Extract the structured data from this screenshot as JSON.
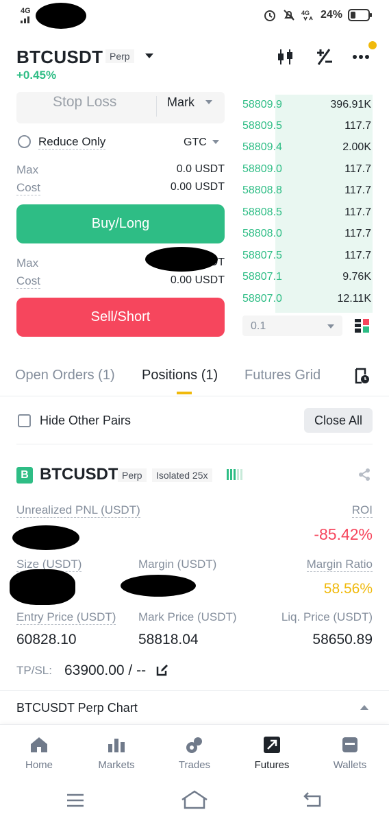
{
  "status_bar": {
    "network": "4G",
    "battery": "24%"
  },
  "header": {
    "pair": "BTCUSDT",
    "contract_type": "Perp",
    "change": "+0.45%"
  },
  "order_form": {
    "stop_loss_placeholder": "Stop Loss",
    "price_type": "Mark",
    "reduce_only": "Reduce Only",
    "time_in_force": "GTC",
    "buy": {
      "max_label": "Max",
      "max_value": "0.0 USDT",
      "cost_label": "Cost",
      "cost_value": "0.00 USDT",
      "button": "Buy/Long"
    },
    "sell": {
      "max_label": "Max",
      "max_value_visible": "DT",
      "cost_label": "Cost",
      "cost_value": "0.00 USDT",
      "button": "Sell/Short"
    }
  },
  "orderbook": {
    "bids": [
      {
        "price": "58809.9",
        "qty": "396.91K"
      },
      {
        "price": "58809.5",
        "qty": "117.7"
      },
      {
        "price": "58809.4",
        "qty": "2.00K"
      },
      {
        "price": "58809.0",
        "qty": "117.7"
      },
      {
        "price": "58808.8",
        "qty": "117.7"
      },
      {
        "price": "58808.5",
        "qty": "117.7"
      },
      {
        "price": "58808.0",
        "qty": "117.7"
      },
      {
        "price": "58807.5",
        "qty": "117.7"
      },
      {
        "price": "58807.1",
        "qty": "9.76K"
      },
      {
        "price": "58807.0",
        "qty": "12.11K"
      }
    ],
    "step": "0.1"
  },
  "tabs": {
    "open_orders": "Open Orders (1)",
    "positions": "Positions (1)",
    "futures_grid": "Futures Grid"
  },
  "positions": {
    "hide_other_pairs": "Hide Other Pairs",
    "close_all": "Close All",
    "badge": "B",
    "pair": "BTCUSDT",
    "contract_type": "Perp",
    "margin_mode": "Isolated 25x",
    "unrealized_pnl_label": "Unrealized PNL (USDT)",
    "roi_label": "ROI",
    "roi_value": "-85.42%",
    "size_label": "Size (USDT)",
    "margin_label": "Margin (USDT)",
    "margin_ratio_label": "Margin Ratio",
    "margin_ratio_value": "58.56%",
    "entry_price_label": "Entry Price (USDT)",
    "entry_price_value": "60828.10",
    "mark_price_label": "Mark Price (USDT)",
    "mark_price_value": "58818.04",
    "liq_price_label": "Liq. Price (USDT)",
    "liq_price_value": "58650.89",
    "tpsl_label": "TP/SL:",
    "tpsl_value": "63900.00 / --"
  },
  "chart": {
    "title": "BTCUSDT Perp Chart"
  },
  "bottom_nav": {
    "items": [
      {
        "label": "Home",
        "icon": "home-icon"
      },
      {
        "label": "Markets",
        "icon": "markets-icon"
      },
      {
        "label": "Trades",
        "icon": "trades-icon"
      },
      {
        "label": "Futures",
        "icon": "futures-icon"
      },
      {
        "label": "Wallets",
        "icon": "wallets-icon"
      }
    ],
    "active": "Futures"
  },
  "colors": {
    "green": "#2ebd85",
    "red": "#f6465d",
    "yellow": "#f0b90b",
    "text": "#1e2329",
    "muted": "#848e9c"
  }
}
